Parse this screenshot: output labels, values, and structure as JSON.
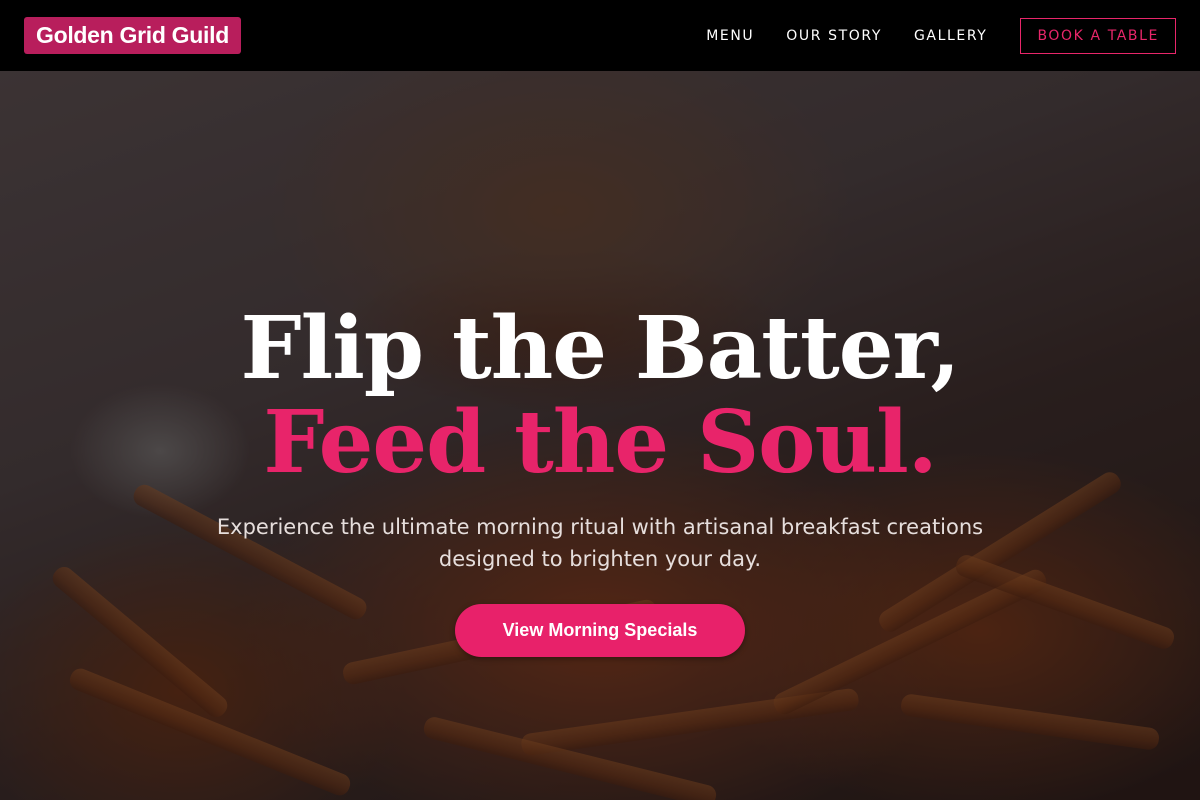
{
  "brand": {
    "name": "Golden Grid Guild"
  },
  "nav": {
    "items": [
      {
        "label": "MENU"
      },
      {
        "label": "OUR STORY"
      },
      {
        "label": "GALLERY"
      }
    ],
    "book_label": "BOOK A TABLE"
  },
  "hero": {
    "headline_line1": "Flip the Batter,",
    "headline_line2": "Feed the Soul.",
    "subtitle": "Experience the ultimate morning ritual with artisanal breakfast creations designed to brighten your day.",
    "cta_label": "View Morning Specials",
    "background_image": "burger-and-fries-photo"
  },
  "colors": {
    "accent": "#e8216a",
    "brand_bg": "#b81e5c",
    "header_bg": "#000000"
  }
}
